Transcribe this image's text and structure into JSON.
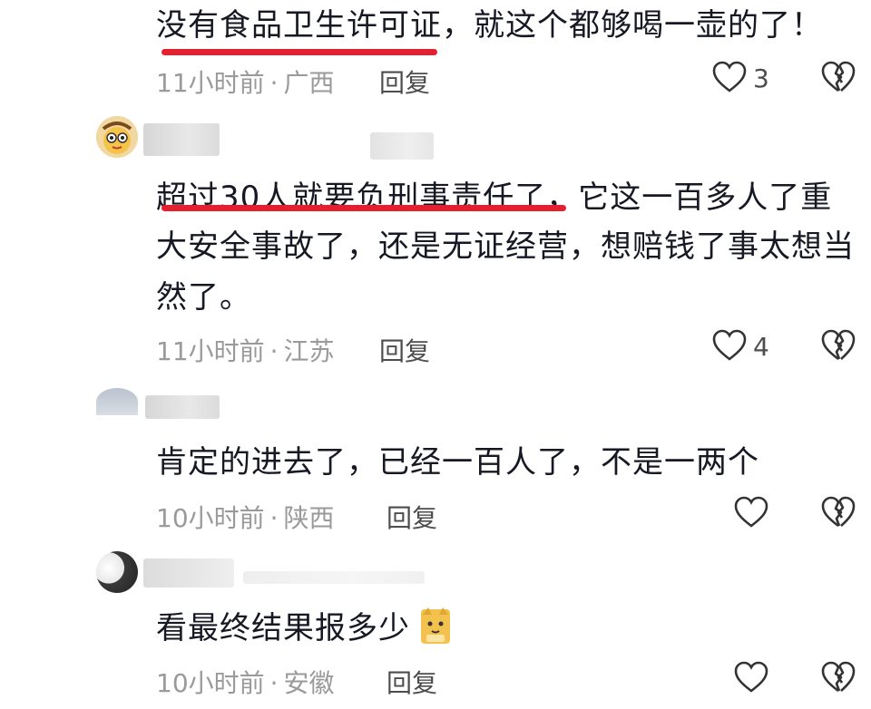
{
  "comments": [
    {
      "text": "没有食品卫生许可证，就这个都够喝一壶的了！",
      "time": "11小时前",
      "location": "广西",
      "reply": "回复",
      "likes": "3"
    },
    {
      "text_line1": "超过30人就要负刑事责任了，它这一百多人了重",
      "text_line2": "大安全事故了，还是无证经营，想赔钱了事太想当",
      "text_line3": "然了。",
      "time": "11小时前",
      "location": "江苏",
      "reply": "回复",
      "likes": "4"
    },
    {
      "text": "肯定的进去了，已经一百人了，不是一两个",
      "time": "10小时前",
      "location": "陕西",
      "reply": "回复",
      "likes": ""
    },
    {
      "text": "看最终结果报多少",
      "time": "10小时前",
      "location": "安徽",
      "reply": "回复",
      "likes": ""
    }
  ],
  "meta_separator": "·",
  "icons": {
    "like": "heart-outline-icon",
    "dislike": "broken-heart-icon",
    "emoji": "cat-emoji-icon"
  },
  "colors": {
    "underline": "#e5202e",
    "meta": "#9a9a9a"
  }
}
